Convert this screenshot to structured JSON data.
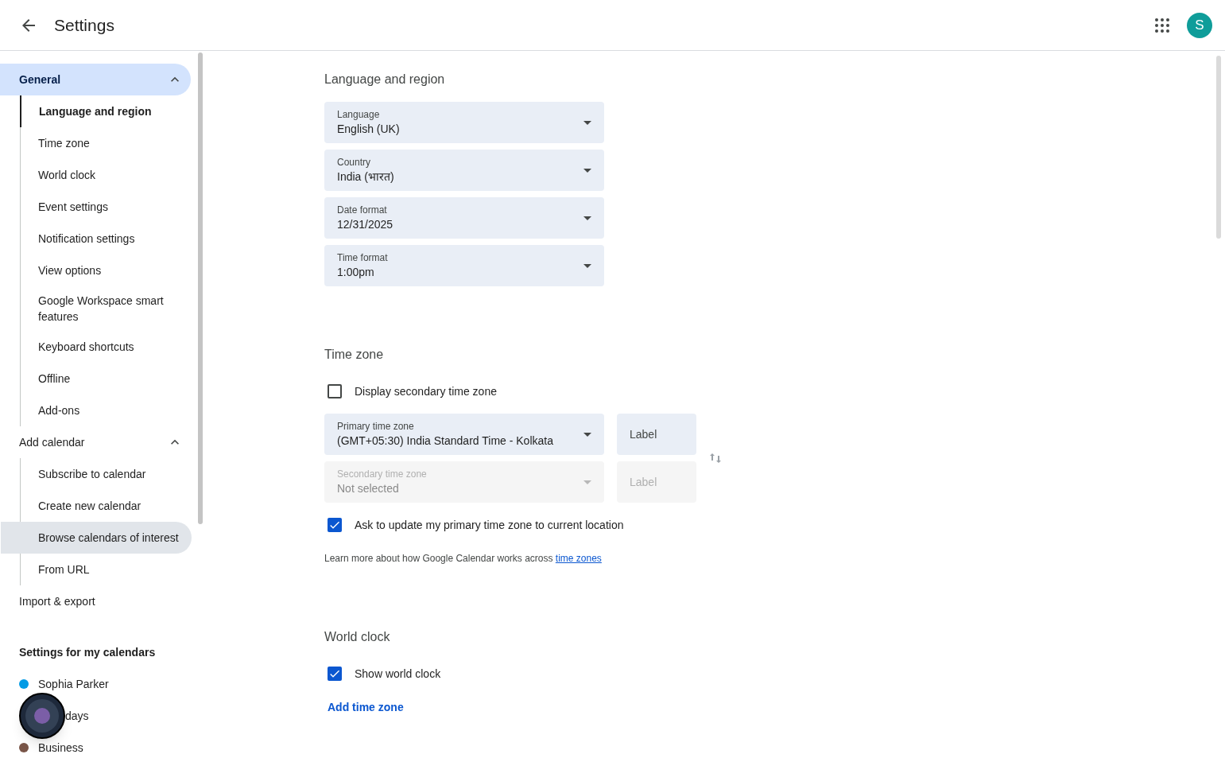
{
  "header": {
    "title": "Settings",
    "avatar_letter": "S"
  },
  "sidebar": {
    "sections": [
      {
        "label": "General",
        "expanded": true,
        "selected": true,
        "children": [
          {
            "label": "Language and region",
            "selected": true,
            "hovered": false
          },
          {
            "label": "Time zone",
            "selected": false,
            "hovered": false
          },
          {
            "label": "World clock",
            "selected": false,
            "hovered": false
          },
          {
            "label": "Event settings",
            "selected": false,
            "hovered": false
          },
          {
            "label": "Notification settings",
            "selected": false,
            "hovered": false
          },
          {
            "label": "View options",
            "selected": false,
            "hovered": false
          },
          {
            "label": "Google Workspace smart features",
            "selected": false,
            "hovered": false
          },
          {
            "label": "Keyboard shortcuts",
            "selected": false,
            "hovered": false
          },
          {
            "label": "Offline",
            "selected": false,
            "hovered": false
          },
          {
            "label": "Add-ons",
            "selected": false,
            "hovered": false
          }
        ]
      },
      {
        "label": "Add calendar",
        "expanded": true,
        "selected": false,
        "children": [
          {
            "label": "Subscribe to calendar",
            "selected": false,
            "hovered": false
          },
          {
            "label": "Create new calendar",
            "selected": false,
            "hovered": false
          },
          {
            "label": "Browse calendars of interest",
            "selected": false,
            "hovered": true
          },
          {
            "label": "From URL",
            "selected": false,
            "hovered": false
          }
        ]
      },
      {
        "label": "Import & export",
        "selected": false
      }
    ],
    "calendars_heading": "Settings for my calendars",
    "calendars": [
      {
        "name": "Sophia Parker",
        "color": "#039be5",
        "covered": false
      },
      {
        "name": "days",
        "covered": true
      },
      {
        "name": "Business",
        "color": "#795548",
        "covered": false
      }
    ]
  },
  "language_region": {
    "heading": "Language and region",
    "dropdowns": [
      {
        "label": "Language",
        "value": "English (UK)"
      },
      {
        "label": "Country",
        "value": "India (भारत)"
      },
      {
        "label": "Date format",
        "value": "12/31/2025"
      },
      {
        "label": "Time format",
        "value": "1:00pm"
      }
    ]
  },
  "time_zone": {
    "heading": "Time zone",
    "secondary_checkbox": {
      "label": "Display secondary time zone",
      "checked": false
    },
    "zones": [
      {
        "label": "Primary time zone",
        "value": "(GMT+05:30) India Standard Time - Kolkata",
        "disabled": false,
        "label_placeholder": "Label"
      },
      {
        "label": "Secondary time zone",
        "placeholder": "Not selected",
        "disabled": true,
        "label_placeholder": "Label"
      }
    ],
    "update_checkbox": {
      "label": "Ask to update my primary time zone to current location",
      "checked": true
    },
    "note": "Learn more about how Google Calendar works across",
    "note_link": "time zones"
  },
  "world_clock": {
    "heading": "World clock",
    "checkbox": {
      "label": "Show world clock",
      "checked": true
    },
    "add_link": "Add time zone"
  }
}
